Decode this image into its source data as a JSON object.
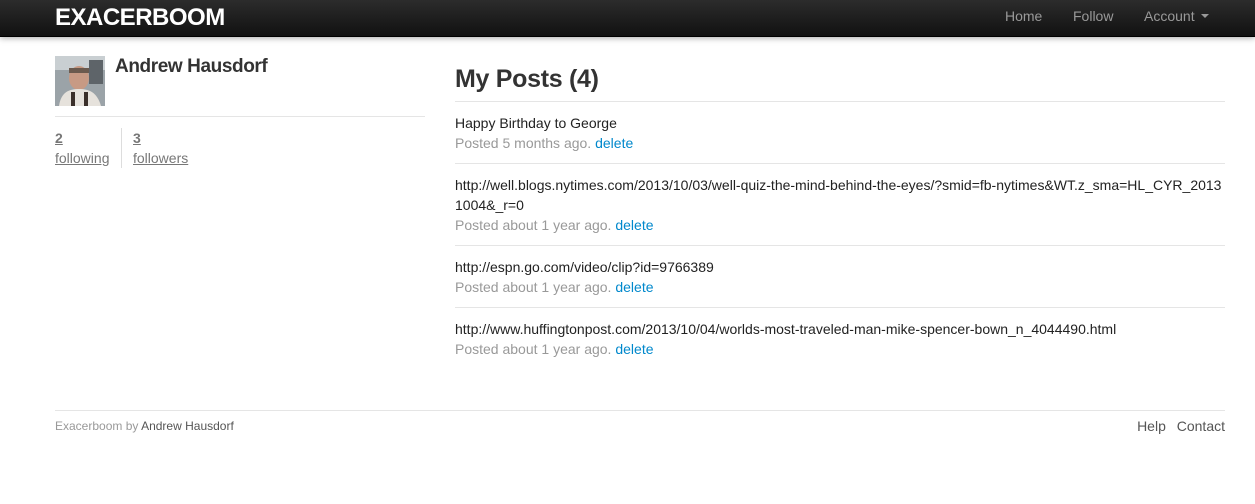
{
  "navbar": {
    "brand": "EXACERBOOM",
    "links": {
      "home": "Home",
      "follow": "Follow",
      "account": "Account"
    }
  },
  "sidebar": {
    "user_name": "Andrew Hausdorf",
    "stats": {
      "following_count": "2",
      "following_label": "following",
      "followers_count": "3",
      "followers_label": "followers"
    }
  },
  "main": {
    "title": "My Posts (4)",
    "posts": [
      {
        "content": "Happy Birthday to George",
        "meta": "Posted 5 months ago.",
        "action": "delete"
      },
      {
        "content": "http://well.blogs.nytimes.com/2013/10/03/well-quiz-the-mind-behind-the-eyes/?smid=fb-nytimes&WT.z_sma=HL_CYR_20131004&_r=0",
        "meta": "Posted about 1 year ago.",
        "action": "delete"
      },
      {
        "content": "http://espn.go.com/video/clip?id=9766389",
        "meta": "Posted about 1 year ago.",
        "action": "delete"
      },
      {
        "content": "http://www.huffingtonpost.com/2013/10/04/worlds-most-traveled-man-mike-spencer-bown_n_4044490.html",
        "meta": "Posted about 1 year ago.",
        "action": "delete"
      }
    ]
  },
  "footer": {
    "site_name": "Exacerboom",
    "by_text": "by",
    "author": "Andrew Hausdorf",
    "links": {
      "help": "Help",
      "contact": "Contact"
    }
  }
}
